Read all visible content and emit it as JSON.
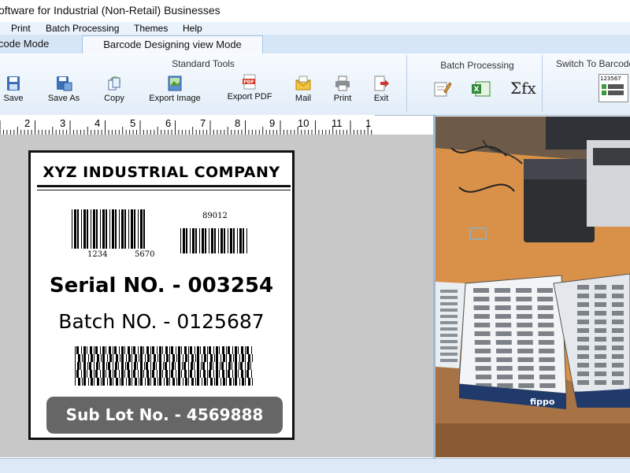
{
  "window": {
    "title": "oftware for Industrial (Non-Retail) Businesses"
  },
  "menu": {
    "items": [
      "Print",
      "Batch Processing",
      "Themes",
      "Help"
    ]
  },
  "tabs": {
    "left": "code Mode",
    "active": "Barcode Designing view Mode"
  },
  "ribbon": {
    "standard_tools": {
      "title": "Standard Tools",
      "tools": [
        "Save",
        "Save As",
        "Copy",
        "Export Image",
        "Export PDF",
        "Mail",
        "Print",
        "Exit"
      ]
    },
    "batch_processing": {
      "title": "Batch Processing",
      "sigma_label": "Σfx"
    },
    "switch": {
      "title": "Switch To Barcode",
      "preview_number": "123567"
    },
    "icon_names": [
      "save-icon",
      "save-as-icon",
      "copy-icon",
      "export-image-icon",
      "export-pdf-icon",
      "mail-icon",
      "print-icon",
      "exit-icon"
    ],
    "pdf_icon_text": "PDF"
  },
  "ruler": {
    "numbers": [
      "2",
      "3",
      "4",
      "5",
      "6",
      "7",
      "8",
      "9",
      "10",
      "11",
      "1"
    ]
  },
  "label": {
    "company": "XYZ INDUSTRIAL COMPANY",
    "barcode_left_nums": [
      "1234",
      "5670"
    ],
    "barcode_right_num": "89012",
    "serial": "Serial NO. - 003254",
    "batch": "Batch NO. - 0125687",
    "sublot": "Sub Lot No. - 4569888"
  },
  "photo": {
    "box_brand": "fippo"
  },
  "colors": {
    "ribbon_bg": "#e3edf8",
    "tab_bg": "#d7e6f6",
    "canvas_bg": "#c8c8c8",
    "sublot_bg": "#666666"
  }
}
